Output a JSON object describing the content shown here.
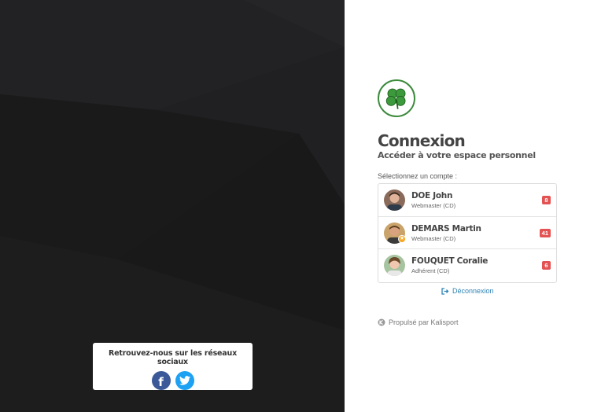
{
  "social": {
    "title": "Retrouvez-nous sur les réseaux sociaux",
    "facebook_icon": "facebook-icon",
    "twitter_icon": "twitter-icon"
  },
  "login": {
    "logo": "clover-logo",
    "title": "Connexion",
    "subtitle": "Accéder à votre espace personnel",
    "select_label": "Sélectionnez un compte :",
    "accounts": [
      {
        "name": "DOE John",
        "role": "Webmaster (CD)",
        "badge": "8"
      },
      {
        "name": "DEMARS Martin",
        "role": "Webmaster (CD)",
        "badge": "41"
      },
      {
        "name": "FOUQUET Coralie",
        "role": "Adhérent (CD)",
        "badge": "6"
      }
    ],
    "logout_label": "Déconnexion",
    "powered_by": "Propulsé par Kalisport"
  },
  "colors": {
    "left_background": "#1c1c1d",
    "accent_link": "#2f83b5",
    "badge_red": "#e35353",
    "brand_green": "#3c8a3c"
  }
}
